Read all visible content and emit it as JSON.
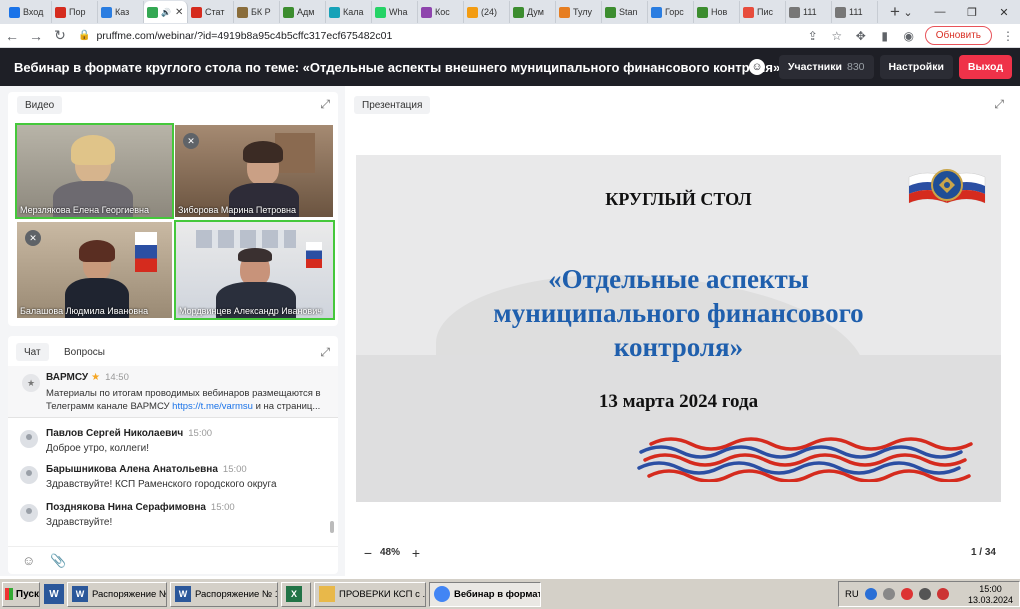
{
  "browser": {
    "tabs": [
      {
        "label": "Вход",
        "color": "#1a73e8"
      },
      {
        "label": "Пор",
        "color": "#d52b1e"
      },
      {
        "label": "Каз",
        "color": "#2a7de1"
      },
      {
        "label": "",
        "color": "#34a853",
        "active": true
      },
      {
        "label": "Стат",
        "color": "#d52b1e"
      },
      {
        "label": "БК Р",
        "color": "#8a6d3b"
      },
      {
        "label": "Адм",
        "color": "#3c8d2f"
      },
      {
        "label": "Кала",
        "color": "#17a2b8"
      },
      {
        "label": "Wha",
        "color": "#25d366"
      },
      {
        "label": "Кос",
        "color": "#8e44ad"
      },
      {
        "label": "(24)",
        "color": "#f39c12"
      },
      {
        "label": "Дум",
        "color": "#3c8d2f"
      },
      {
        "label": "Тулу",
        "color": "#e67e22"
      },
      {
        "label": "Stan",
        "color": "#3c8d2f"
      },
      {
        "label": "Горс",
        "color": "#2a7de1"
      },
      {
        "label": "Нов",
        "color": "#3c8d2f"
      },
      {
        "label": "Пис",
        "color": "#e74c3c"
      },
      {
        "label": "111",
        "color": "#777777"
      },
      {
        "label": "111",
        "color": "#777777"
      }
    ],
    "url": "pruffme.com/webinar/?id=4919b8a95c4b5cffc317ecf675482c01",
    "update_label": "Обновить"
  },
  "header": {
    "title": "Вебинар в формате круглого стола по теме: «Отдельные аспекты внешнего муниципального финансового контроля»",
    "participants_label": "Участники",
    "participants_count": "830",
    "settings_label": "Настройки",
    "exit_label": "Выход"
  },
  "video": {
    "label": "Видео",
    "tiles": [
      {
        "name": "Мерзлякова Елена Георгиевна"
      },
      {
        "name": "Зиборова Марина Петровна"
      },
      {
        "name": "Балашова Людмила Ивановна"
      },
      {
        "name": "Мордвинцев Александр Иванович"
      }
    ]
  },
  "chat": {
    "tab_chat": "Чат",
    "tab_questions": "Вопросы",
    "pinned": {
      "author": "ВАРМСУ",
      "time": "14:50",
      "text": "Материалы по итогам проводимых вебинаров размещаются в Телеграмм канале ВАРМСУ ",
      "link": "https://t.me/varmsu",
      "text_tail": " и на страниц..."
    },
    "messages": [
      {
        "author": "Павлов Сергей Николаевич",
        "time": "15:00",
        "text": "Доброе утро, коллеги!"
      },
      {
        "author": "Барышникова Алена Анатольевна",
        "time": "15:00",
        "text": "Здравствуйте! КСП Раменского городского округа"
      },
      {
        "author": "Позднякова Нина Серафимовна",
        "time": "15:00",
        "text": "Здравствуйте!"
      }
    ]
  },
  "presentation": {
    "label": "Презентация",
    "slide_title": "КРУГЛЫЙ СТОЛ",
    "slide_subtitle_lines": [
      "«Отдельные аспекты",
      "муниципального финансового",
      "контроля»"
    ],
    "slide_date": "13 марта 2024 года",
    "zoom": "48%",
    "page": "1 / 34"
  },
  "taskbar": {
    "start_label": "Пуск",
    "tasks": [
      {
        "label": "Распоряжение №...",
        "icon": "W",
        "color": "#2b579a"
      },
      {
        "label": "Распоряжение № 1...",
        "icon": "W",
        "color": "#2b579a"
      },
      {
        "label": "",
        "icon": "X",
        "color": "#217346"
      },
      {
        "label": "ПРОВЕРКИ КСП с ...",
        "icon": "",
        "color": "#e8b84a"
      },
      {
        "label": "Вебинар в формат...",
        "icon": "",
        "color": "#4285f4",
        "active": true
      }
    ],
    "lang": "RU",
    "time": "15:00",
    "date": "13.03.2024"
  }
}
